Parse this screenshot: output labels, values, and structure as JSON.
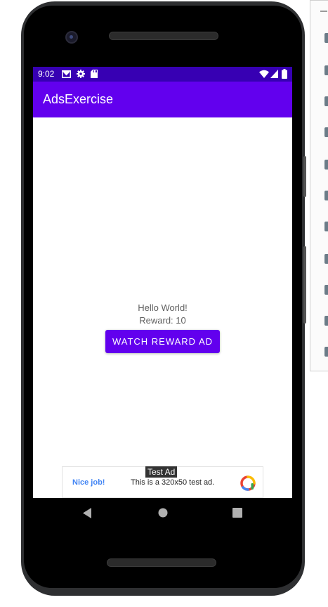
{
  "status_bar": {
    "time": "9:02",
    "bg_color": "#3700b3",
    "left_icons": [
      "gmail-icon",
      "settings-icon",
      "sd-card-icon"
    ],
    "right_icons": [
      "wifi-icon",
      "signal-icon",
      "battery-icon"
    ]
  },
  "app_bar": {
    "title": "AdsExercise",
    "bg_color": "#6200ee"
  },
  "main": {
    "hello_text": "Hello World!",
    "reward_text": "Reward: 10",
    "watch_button_label": "WATCH REWARD AD"
  },
  "ad": {
    "label": "Test Ad",
    "headline": "Nice job!",
    "body": "This is a 320x50 test ad.",
    "logo_icon": "admob-logo-icon"
  },
  "nav_bar": {
    "icons": [
      "back-icon",
      "home-icon",
      "recents-icon"
    ]
  }
}
